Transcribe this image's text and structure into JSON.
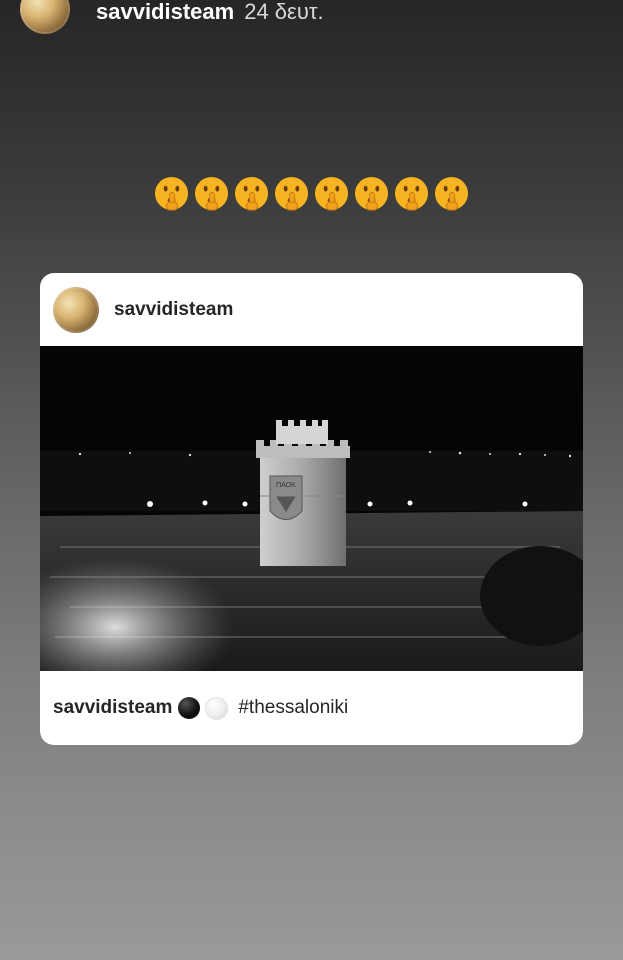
{
  "story": {
    "username": "savvidisteam",
    "timestamp": "24 δευτ."
  },
  "sticker": {
    "emoji_name": "shushing-face-emoji",
    "emoji_count": 8
  },
  "post": {
    "username": "savvidisteam",
    "image": "black-and-white aerial photo of White Tower of Thessaloniki with crowd at night",
    "caption": {
      "username": "savvidisteam",
      "emojis": [
        "black-circle",
        "white-circle"
      ],
      "hashtag": "#thessaloniki"
    }
  },
  "colors": {
    "background_top": "#262626",
    "background_bottom": "#9a9a9a",
    "card": "#ffffff",
    "emoji": "#f7b422"
  }
}
